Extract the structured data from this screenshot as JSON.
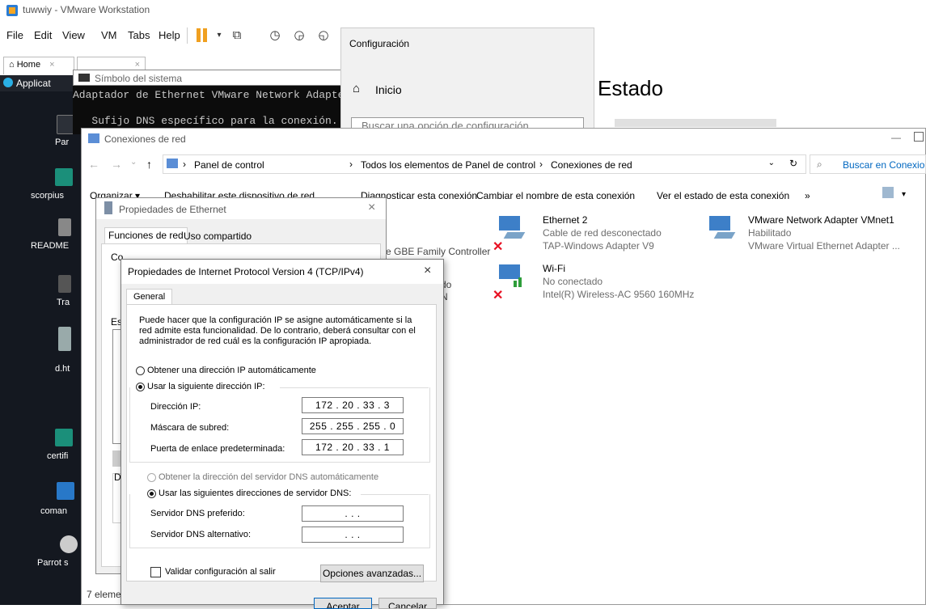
{
  "vmware": {
    "title": "tuwwiy - VMware Workstation",
    "menu": [
      "File",
      "Edit",
      "View",
      "VM",
      "Tabs",
      "Help"
    ],
    "tabs": {
      "home": "Home",
      "close": "×"
    },
    "applications": "Applicat"
  },
  "desktop_icons": [
    {
      "label": "Par"
    },
    {
      "label": "scorpius"
    },
    {
      "label": "README"
    },
    {
      "label": "Tra"
    },
    {
      "label": "d.ht"
    },
    {
      "label": "certifi"
    },
    {
      "label": "coman"
    },
    {
      "label": "Parrot s"
    }
  ],
  "cmd": {
    "title": "Símbolo del sistema",
    "line1": "Adaptador de Ethernet VMware Network Adapter V",
    "line2": "   Sufijo DNS específico para la conexión. . :"
  },
  "settings": {
    "title": "Configuración",
    "home": "Inicio",
    "search_placeholder": "Buscar una opción de configuración",
    "status": "Estado"
  },
  "network": {
    "title": "Conexiones de red",
    "breadcrumb": [
      "Panel de control",
      "Todos los elementos de Panel de control",
      "Conexiones de red"
    ],
    "search": "Buscar en Conexion",
    "commands": [
      "Organizar ▾",
      "Deshabilitar este dispositivo de red",
      "Diagnosticar esta conexión",
      "Cambiar el nombre de esta conexión",
      "Ver el estado de esta conexión",
      "»"
    ],
    "partial": {
      "controller": "e GBE Family Controller",
      "do": "do",
      "n": "N"
    },
    "connections": [
      {
        "name": "Ethernet 2",
        "status": "Cable de red desconectado",
        "device": "TAP-Windows Adapter V9",
        "error": true
      },
      {
        "name": "VMware Network Adapter VMnet1",
        "status": "Habilitado",
        "device": "VMware Virtual Ethernet Adapter ...",
        "error": false
      },
      {
        "name": "Wi-Fi",
        "status": "No conectado",
        "device": "Intel(R) Wireless-AC 9560 160MHz",
        "error": true
      }
    ],
    "status_bar": "7 eleme"
  },
  "ethernet_props": {
    "title": "Propiedades de Ethernet",
    "tabs": [
      "Funciones de red",
      "Uso compartido"
    ],
    "partial_label": "Co",
    "partial_es": "Es",
    "partial_d": "D"
  },
  "ipv4": {
    "title": "Propiedades de Internet Protocol Version 4 (TCP/IPv4)",
    "tab": "General",
    "description": "Puede hacer que la configuración IP se asigne automáticamente si la red admite esta funcionalidad. De lo contrario, deberá consultar con el administrador de red cuál es la configuración IP apropiada.",
    "auto_ip": "Obtener una dirección IP automáticamente",
    "manual_ip": "Usar la siguiente dirección IP:",
    "ip_label": "Dirección IP:",
    "ip_value": "172 . 20 . 33 . 3",
    "mask_label": "Máscara de subred:",
    "mask_value": "255 . 255 . 255 . 0",
    "gateway_label": "Puerta de enlace predeterminada:",
    "gateway_value": "172 . 20 . 33 . 1",
    "auto_dns": "Obtener la dirección del servidor DNS automáticamente",
    "manual_dns": "Usar las siguientes direcciones de servidor DNS:",
    "dns1_label": "Servidor DNS preferido:",
    "dns1_value": ".      .      .",
    "dns2_label": "Servidor DNS alternativo:",
    "dns2_value": ".      .      .",
    "validate": "Validar configuración al salir",
    "advanced": "Opciones avanzadas...",
    "ok": "Aceptar",
    "cancel": "Cancelar",
    "close": "×"
  },
  "colors": {
    "accent": "#0067c0",
    "error": "#e81123",
    "desktop": "#141820"
  }
}
